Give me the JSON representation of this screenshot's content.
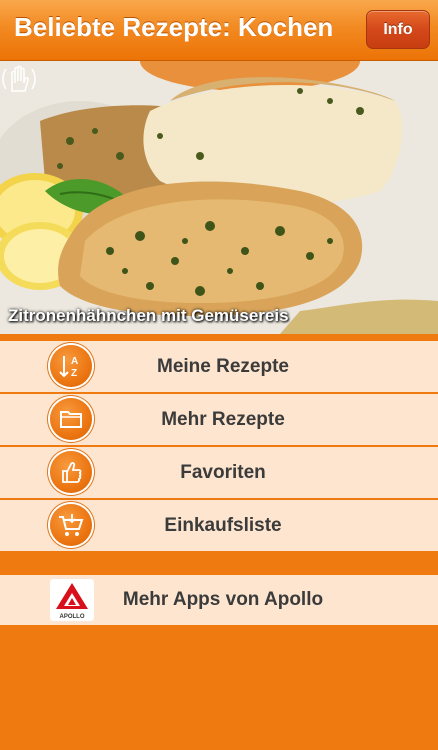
{
  "header": {
    "title": "Beliebte Rezepte: Kochen",
    "info_label": "Info"
  },
  "photo": {
    "caption": "Zitronenhähnchen mit Gemüsereis",
    "swipe_icon": "hand-swipe-icon"
  },
  "menu": {
    "items": [
      {
        "label": "Meine Rezepte",
        "icon": "sort-az-icon"
      },
      {
        "label": "Mehr Rezepte",
        "icon": "folder-icon"
      },
      {
        "label": "Favoriten",
        "icon": "thumbs-up-icon"
      },
      {
        "label": "Einkaufsliste",
        "icon": "shopping-cart-icon"
      }
    ]
  },
  "more_apps": {
    "label": "Mehr Apps von Apollo",
    "logo_text": "APOLLO",
    "icon": "apollo-logo"
  },
  "colors": {
    "accent": "#ef7a10",
    "row_bg": "#fde5cf",
    "text": "#3b3b3b"
  }
}
